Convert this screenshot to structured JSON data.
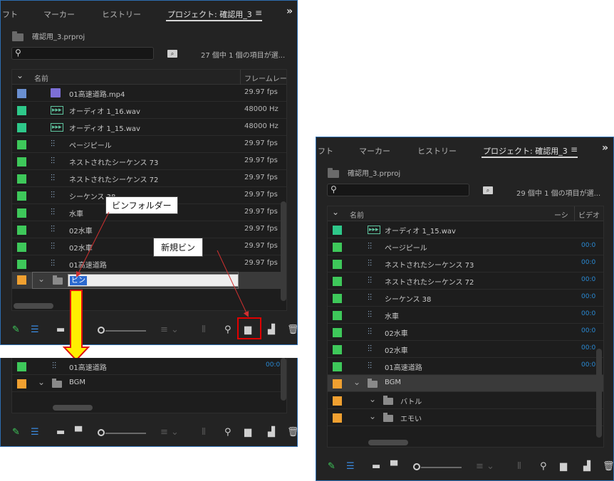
{
  "panel_main": {
    "tabs": [
      "フト",
      "マーカー",
      "ヒストリー",
      "プロジェクト: 確認用_3"
    ],
    "menu_glyph": "≡",
    "overflow_glyph": "»",
    "project_file": "確認用_3.prproj",
    "search_placeholder": "",
    "item_count": "27 個中 1 個の項目が選...",
    "columns": [
      "名前",
      "フレームレー"
    ],
    "rows": [
      {
        "name": "01高速道路.mp4",
        "rate": "29.97 fps",
        "color": "#6a8fd0",
        "icon": "video-clip-icon"
      },
      {
        "name": "オーディオ 1_16.wav",
        "rate": "48000 Hz",
        "color": "#2ec88a",
        "icon": "audio-clip-icon"
      },
      {
        "name": "オーディオ 1_15.wav",
        "rate": "48000 Hz",
        "color": "#2ec88a",
        "icon": "audio-clip-icon"
      },
      {
        "name": "ページピール",
        "rate": "29.97 fps",
        "color": "#3ec85a",
        "icon": "sequence-icon"
      },
      {
        "name": "ネストされたシーケンス 73",
        "rate": "29.97 fps",
        "color": "#3ec85a",
        "icon": "sequence-icon"
      },
      {
        "name": "ネストされたシーケンス 72",
        "rate": "29.97 fps",
        "color": "#3ec85a",
        "icon": "sequence-icon"
      },
      {
        "name": "シーケンス 38",
        "rate": "29.97 fps",
        "color": "#3ec85a",
        "icon": "sequence-icon"
      },
      {
        "name": "水車",
        "rate": "29.97 fps",
        "color": "#3ec85a",
        "icon": "sequence-icon"
      },
      {
        "name": "02水車",
        "rate": "29.97 fps",
        "color": "#3ec85a",
        "icon": "sequence-icon"
      },
      {
        "name": "02水車",
        "rate": "29.97 fps",
        "color": "#3ec85a",
        "icon": "sequence-icon"
      },
      {
        "name": "01高速道路",
        "rate": "29.97 fps",
        "color": "#3ec85a",
        "icon": "sequence-icon"
      }
    ],
    "new_bin": {
      "name": "ビン",
      "color": "#f0a030"
    }
  },
  "callouts": {
    "bin_folder": "ビンフォルダー",
    "new_bin": "新規ビン"
  },
  "panel_lower": {
    "rows": [
      {
        "name": "01高速道路",
        "timecode": "00:0",
        "color": "#3ec85a",
        "icon": "sequence-icon"
      },
      {
        "name": "BGM",
        "color": "#f0a030",
        "icon": "folder-icon"
      }
    ]
  },
  "panel_right": {
    "tabs": [
      "フト",
      "マーカー",
      "ヒストリー",
      "プロジェクト: 確認用_3"
    ],
    "menu_glyph": "≡",
    "overflow_glyph": "»",
    "project_file": "確認用_3.prproj",
    "item_count": "29 個中 1 個の項目が選...",
    "columns": [
      "名前",
      "ーシ",
      "ビデオ"
    ],
    "rows": [
      {
        "name": "オーディオ 1_15.wav",
        "timecode": "",
        "color": "#2ec88a",
        "icon": "audio-clip-icon",
        "indent": 0
      },
      {
        "name": "ページピール",
        "timecode": "00:0",
        "color": "#3ec85a",
        "icon": "sequence-icon",
        "indent": 0
      },
      {
        "name": "ネストされたシーケンス 73",
        "timecode": "00:0",
        "color": "#3ec85a",
        "icon": "sequence-icon",
        "indent": 0
      },
      {
        "name": "ネストされたシーケンス 72",
        "timecode": "00:0",
        "color": "#3ec85a",
        "icon": "sequence-icon",
        "indent": 0
      },
      {
        "name": "シーケンス 38",
        "timecode": "00:0",
        "color": "#3ec85a",
        "icon": "sequence-icon",
        "indent": 0
      },
      {
        "name": "水車",
        "timecode": "00:0",
        "color": "#3ec85a",
        "icon": "sequence-icon",
        "indent": 0
      },
      {
        "name": "02水車",
        "timecode": "00:0",
        "color": "#3ec85a",
        "icon": "sequence-icon",
        "indent": 0
      },
      {
        "name": "02水車",
        "timecode": "00:0",
        "color": "#3ec85a",
        "icon": "sequence-icon",
        "indent": 0
      },
      {
        "name": "01高速道路",
        "timecode": "00:0",
        "color": "#3ec85a",
        "icon": "sequence-icon",
        "indent": 0
      },
      {
        "name": "BGM",
        "timecode": "",
        "color": "#f0a030",
        "icon": "folder-icon",
        "indent": 0,
        "selected": true
      },
      {
        "name": "バトル",
        "timecode": "",
        "color": "#f0a030",
        "icon": "folder-icon",
        "indent": 1
      },
      {
        "name": "エモい",
        "timecode": "",
        "color": "#f0a030",
        "icon": "folder-icon",
        "indent": 1
      }
    ]
  },
  "colors": {
    "panel_bg": "#232323",
    "accent_blue": "#2a8ad4",
    "highlight_red": "#e00000",
    "arrow_yellow": "#ffee00"
  }
}
